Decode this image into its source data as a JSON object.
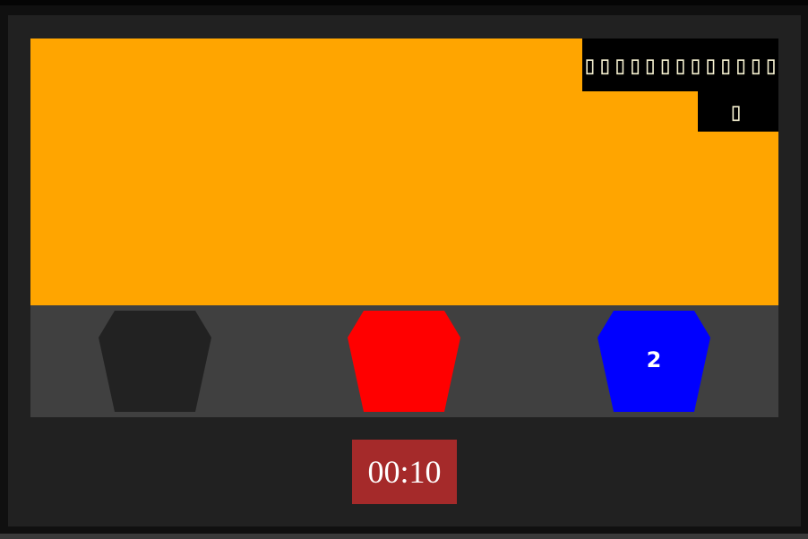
{
  "game": {
    "hud": {
      "score_text": "▯▯▯▯▯▯▯▯▯▯▯▯▯▯",
      "count_text": "▯"
    },
    "colors": {
      "background": "#101010",
      "frame": "#212121",
      "scene": "#ffa500",
      "tray": "#404040",
      "hud": "#000000",
      "timer": "#a52a2a"
    },
    "buckets": [
      {
        "color": "#222222",
        "label": ""
      },
      {
        "color": "#ff0000",
        "label": ""
      },
      {
        "color": "#0000ff",
        "label": "2"
      }
    ],
    "timer": "00:10"
  }
}
